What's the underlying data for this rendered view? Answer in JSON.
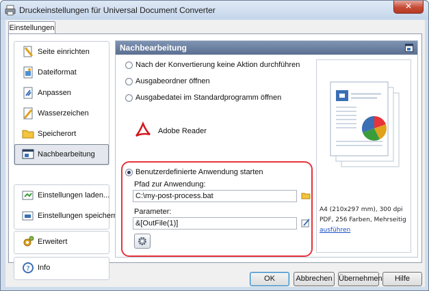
{
  "window": {
    "title": "Druckeinstellungen für Universal Document Converter",
    "close_label": "✕"
  },
  "tab": {
    "label": "Einstellungen"
  },
  "sidebar": {
    "groups": [
      {
        "items": [
          {
            "label": "Seite einrichten",
            "icon": "page-setup-icon",
            "selected": false
          },
          {
            "label": "Dateiformat",
            "icon": "file-format-icon",
            "selected": false
          },
          {
            "label": "Anpassen",
            "icon": "adjust-icon",
            "selected": false
          },
          {
            "label": "Wasserzeichen",
            "icon": "watermark-icon",
            "selected": false
          },
          {
            "label": "Speicherort",
            "icon": "folder-icon",
            "selected": false
          },
          {
            "label": "Nachbearbeitung",
            "icon": "postprocess-icon",
            "selected": true
          }
        ]
      },
      {
        "items": [
          {
            "label": "Einstellungen laden...",
            "icon": "load-settings-icon"
          },
          {
            "label": "Einstellungen speichern...",
            "icon": "save-settings-icon"
          }
        ]
      },
      {
        "items": [
          {
            "label": "Erweitert",
            "icon": "advanced-icon"
          }
        ]
      },
      {
        "items": [
          {
            "label": "Info",
            "icon": "info-icon"
          }
        ]
      }
    ]
  },
  "content": {
    "header": "Nachbearbeitung",
    "options": [
      {
        "label": "Nach der Konvertierung keine Aktion durchführen",
        "checked": false
      },
      {
        "label": "Ausgabeordner öffnen",
        "checked": false
      },
      {
        "label": "Ausgabedatei im Standardprogramm öffnen",
        "checked": false
      },
      {
        "label": "Benutzerdefinierte Anwendung starten",
        "checked": true
      }
    ],
    "default_program": "Adobe Reader",
    "app_path": {
      "label": "Pfad zur Anwendung:",
      "value": "C:\\my-post-process.bat"
    },
    "parameters": {
      "label": "Parameter:",
      "value": "&[OutFile(1)]"
    }
  },
  "preview": {
    "line1": "A4 (210x297 mm), 300 dpi",
    "line2": "PDF, 256 Farben, Mehrseitig",
    "link": "ausführen"
  },
  "buttons": {
    "ok": "OK",
    "cancel": "Abbrechen",
    "apply": "Übernehmen",
    "help": "Hilfe"
  },
  "colors": {
    "highlight_border": "#e8333a",
    "header_bg": "#6a7fa2",
    "adobe_red": "#d4171d"
  }
}
